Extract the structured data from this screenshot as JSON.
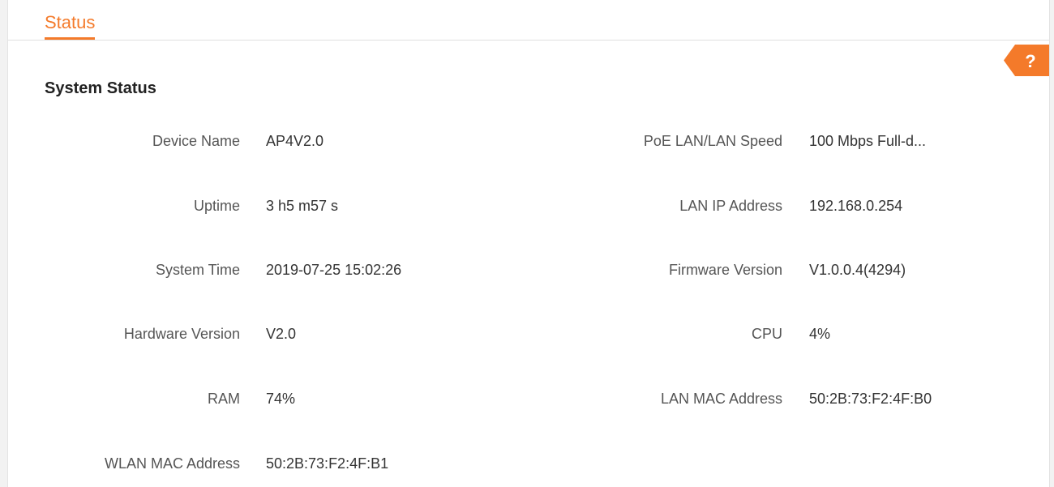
{
  "tab": {
    "label": "Status"
  },
  "help": {
    "symbol": "?"
  },
  "section": {
    "title": "System Status"
  },
  "left": [
    {
      "label": "Device Name",
      "value": "AP4V2.0"
    },
    {
      "label": "Uptime",
      "value": "3 h5 m57 s"
    },
    {
      "label": "System Time",
      "value": "2019-07-25 15:02:26"
    },
    {
      "label": "Hardware Version",
      "value": "V2.0"
    },
    {
      "label": "RAM",
      "value": "74%"
    },
    {
      "label": "WLAN MAC Address",
      "value": "50:2B:73:F2:4F:B1"
    }
  ],
  "right": [
    {
      "label": "PoE LAN/LAN Speed",
      "value": "100 Mbps Full-d..."
    },
    {
      "label": "LAN IP Address",
      "value": "192.168.0.254"
    },
    {
      "label": "Firmware Version",
      "value": "V1.0.0.4(4294)"
    },
    {
      "label": "CPU",
      "value": "4%"
    },
    {
      "label": "LAN MAC Address",
      "value": "50:2B:73:F2:4F:B0"
    }
  ],
  "colors": {
    "accent": "#f47a2a"
  }
}
